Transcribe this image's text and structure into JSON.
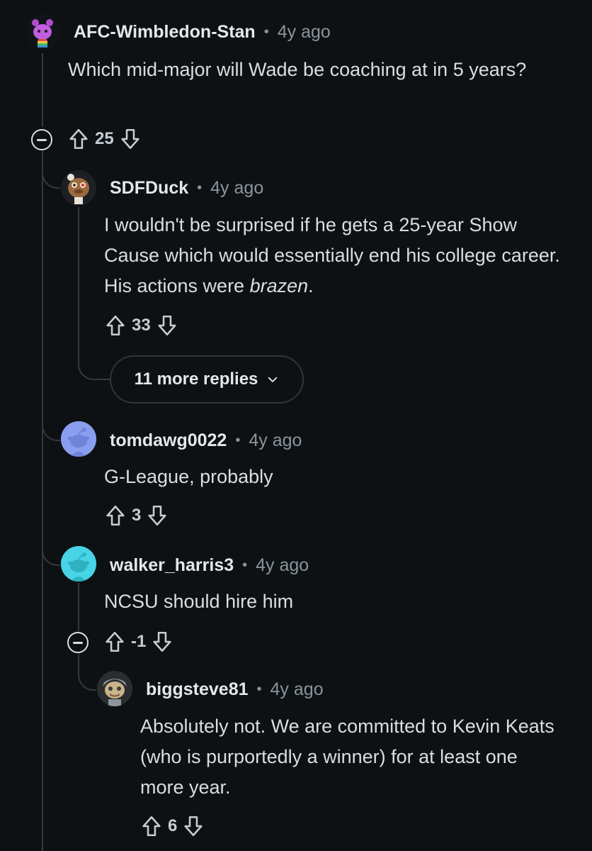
{
  "comments": [
    {
      "username": "AFC-Wimbledon-Stan",
      "separator": "•",
      "time": "4y ago",
      "body": "Which mid-major will Wade be coaching at in 5 years?",
      "score": "25",
      "avatar": "purple-snoo-avatar"
    },
    {
      "username": "SDFDuck",
      "separator": "•",
      "time": "4y ago",
      "body_parts": [
        "I wouldn't be surprised if he gets a 25-year Show Cause which would essentially end his college career. His actions were ",
        "brazen",
        "."
      ],
      "score": "33",
      "avatar": "brown-snoo-avatar"
    },
    {
      "username": "tomdawg0022",
      "separator": "•",
      "time": "4y ago",
      "body": "G-League, probably",
      "score": "3",
      "avatar": "default-blue-snoo-avatar"
    },
    {
      "username": "walker_harris3",
      "separator": "•",
      "time": "4y ago",
      "body": "NCSU should hire him",
      "score": "-1",
      "avatar": "default-teal-snoo-avatar"
    },
    {
      "username": "biggsteve81",
      "separator": "•",
      "time": "4y ago",
      "body": "Absolutely not. We are committed to Kevin Keats (who is purportedly a winner) for at least one more year.",
      "score": "6",
      "avatar": "gray-snoo-avatar"
    }
  ],
  "more_replies": {
    "label": "11 more replies",
    "icon": "chevron-down-icon"
  },
  "icons": {
    "upvote": "upvote-arrow-icon",
    "downvote": "downvote-arrow-icon",
    "collapse": "collapse-thread-icon"
  },
  "colors": {
    "background": "#0e1113",
    "text": "#d9dee2",
    "meta": "#8a959c",
    "thread_line": "#33393d"
  }
}
